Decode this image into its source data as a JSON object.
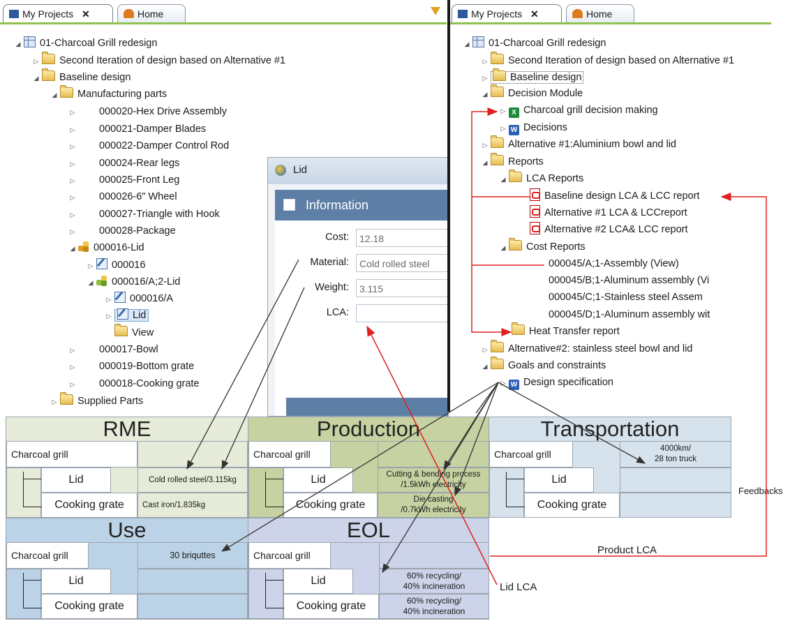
{
  "left_panel": {
    "tabs": [
      {
        "label": "My Projects"
      },
      {
        "label": "Home"
      }
    ],
    "tree": [
      {
        "label": "01-Charcoal Grill redesign"
      },
      {
        "label": "Second Iteration of design based on Alternative #1"
      },
      {
        "label": "Baseline design"
      },
      {
        "label": "Manufacturing parts"
      },
      {
        "label": "000020-Hex Drive Assembly"
      },
      {
        "label": "000021-Damper Blades"
      },
      {
        "label": "000022-Damper Control Rod"
      },
      {
        "label": "000024-Rear legs"
      },
      {
        "label": "000025-Front Leg"
      },
      {
        "label": "000026-6\" Wheel"
      },
      {
        "label": "000027-Triangle with Hook"
      },
      {
        "label": "000028-Package"
      },
      {
        "label": "000016-Lid"
      },
      {
        "label": "000016"
      },
      {
        "label": "000016/A;2-Lid"
      },
      {
        "label": "000016/A"
      },
      {
        "label": "Lid"
      },
      {
        "label": "View"
      },
      {
        "label": "000017-Bowl"
      },
      {
        "label": "000019-Bottom grate"
      },
      {
        "label": "000018-Cooking grate"
      },
      {
        "label": "Supplied Parts"
      }
    ]
  },
  "right_panel": {
    "tabs": [
      {
        "label": "My Projects"
      },
      {
        "label": "Home"
      }
    ],
    "tree": [
      {
        "label": "01-Charcoal Grill redesign"
      },
      {
        "label": "Second Iteration of design based on Alternative #1"
      },
      {
        "label": "Baseline design"
      },
      {
        "label": "Decision Module"
      },
      {
        "label": "Charcoal grill decision making"
      },
      {
        "label": "Decisions"
      },
      {
        "label": "Alternative #1:Aluminium bowl and lid"
      },
      {
        "label": "Reports"
      },
      {
        "label": "LCA Reports"
      },
      {
        "label": "Baseline design LCA & LCC report"
      },
      {
        "label": "Alternative #1 LCA & LCCreport"
      },
      {
        "label": "Alternative #2 LCA& LCC report"
      },
      {
        "label": "Cost Reports"
      },
      {
        "label": "000045/A;1-Assembly (View)"
      },
      {
        "label": "000045/B;1-Aluminum assembly (Vi"
      },
      {
        "label": "000045/C;1-Stainless steel Assem"
      },
      {
        "label": "000045/D;1-Aluminum assembly wit"
      },
      {
        "label": "Heat Transfer report"
      },
      {
        "label": "Alternative#2: stainless steel bowl and lid"
      },
      {
        "label": "Goals and constraints"
      },
      {
        "label": "Design specification"
      }
    ]
  },
  "dialog": {
    "title": "Lid",
    "header": "Information",
    "fields": [
      {
        "label": "Cost:",
        "value": "12.18"
      },
      {
        "label": "Material:",
        "value": "Cold rolled steel"
      },
      {
        "label": "Weight:",
        "value": "3.115"
      },
      {
        "label": "LCA:",
        "value": ""
      }
    ]
  },
  "lifecycle": {
    "rme": {
      "title": "RME",
      "root": "Charcoal grill",
      "child1": "Lid",
      "child2": "Cooking grate",
      "v1": "Cold rolled steel/3.115kg",
      "v2": "Cast iron/1.835kg"
    },
    "production": {
      "title": "Production",
      "root": "Charcoal grill",
      "child1": "Lid",
      "child2": "Cooking grate",
      "v1a": "Cutting & bending process",
      "v1b": "/1.5kWh electricity",
      "v2a": "Die casting",
      "v2b": "/0.7kWh electricity"
    },
    "transportation": {
      "title": "Transportation",
      "root": "Charcoal grill",
      "child1": "Lid",
      "child2": "Cooking grate",
      "v0a": "4000km/",
      "v0b": "28 ton truck"
    },
    "use": {
      "title": "Use",
      "root": "Charcoal grill",
      "child1": "Lid",
      "child2": "Cooking grate",
      "v0": "30 briquttes"
    },
    "eol": {
      "title": "EOL",
      "root": "Charcoal grill",
      "child1": "Lid",
      "child2": "Cooking grate",
      "v1a": "60% recycling/",
      "v1b": "40% incineration",
      "v2a": "60% recycling/",
      "v2b": "40% incineration"
    }
  },
  "annotations": {
    "feedbacks": "Feedbacks",
    "product_lca": "Product LCA",
    "lid_lca": "Lid LCA"
  },
  "colors": {
    "rme": "#e6ecd9",
    "production": "#c6d2a2",
    "transportation": "#d6e3ec",
    "use": "#bcd3e7",
    "eol": "#cdd3e8",
    "arrow_red": "#e02020",
    "tab_accent": "#90c050"
  }
}
